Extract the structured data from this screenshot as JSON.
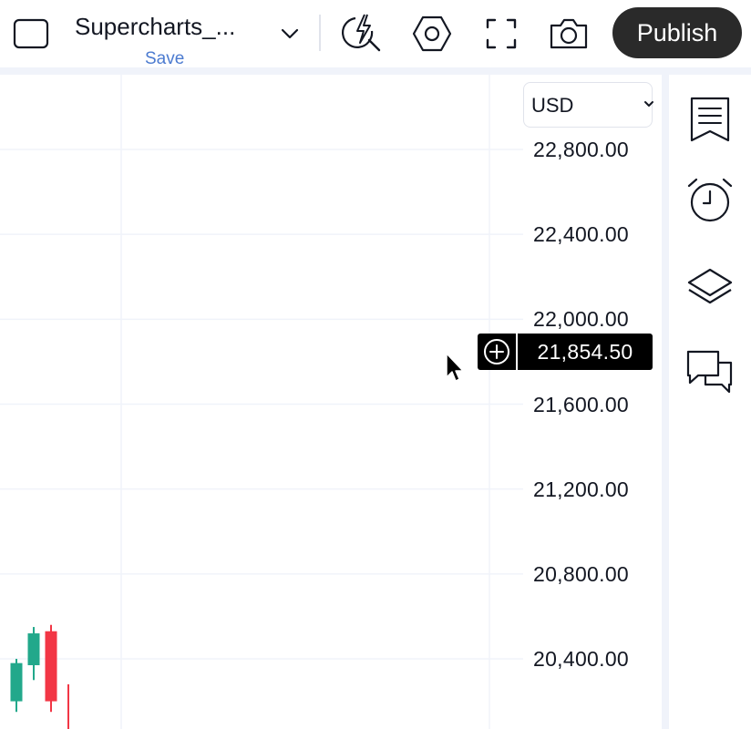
{
  "toolbar": {
    "layout_icon": "square-layout-icon",
    "chart_title": "Supercharts_...",
    "save_label": "Save",
    "dropdown_icon": "chevron-down-icon",
    "quick_search_icon": "lightning-search-icon",
    "settings_icon": "hexagon-settings-icon",
    "fullscreen_icon": "fullscreen-icon",
    "snapshot_icon": "camera-icon",
    "publish_label": "Publish"
  },
  "chart": {
    "currency": "USD",
    "price_scale": [
      "22,800.00",
      "22,400.00",
      "22,000.00",
      "21,600.00",
      "21,200.00",
      "20,800.00",
      "20,400.00"
    ],
    "crosshair_price": "21,854.50",
    "crosshair_add_icon": "plus-circle-icon",
    "colors": {
      "up": "#22a88b",
      "down": "#f23645",
      "grid": "#f0f3fa",
      "text": "#131722"
    }
  },
  "chart_data": {
    "type": "candlestick",
    "title": "",
    "ylabel": "",
    "ylim": [
      20300,
      22900
    ],
    "candles": [
      {
        "open": 20200,
        "close": 20380,
        "high": 20400,
        "low": 20150,
        "direction": "up"
      },
      {
        "open": 20370,
        "close": 20520,
        "high": 20550,
        "low": 20300,
        "direction": "up"
      },
      {
        "open": 20530,
        "close": 20200,
        "high": 20560,
        "low": 20150,
        "direction": "down"
      },
      {
        "open": 20170,
        "close": 20120,
        "high": 20280,
        "low": 20050,
        "direction": "down"
      }
    ]
  },
  "sidebar": {
    "items": [
      {
        "icon": "watchlist-icon"
      },
      {
        "icon": "alarm-clock-icon"
      },
      {
        "icon": "layers-icon"
      },
      {
        "icon": "chat-bubbles-icon"
      }
    ]
  }
}
